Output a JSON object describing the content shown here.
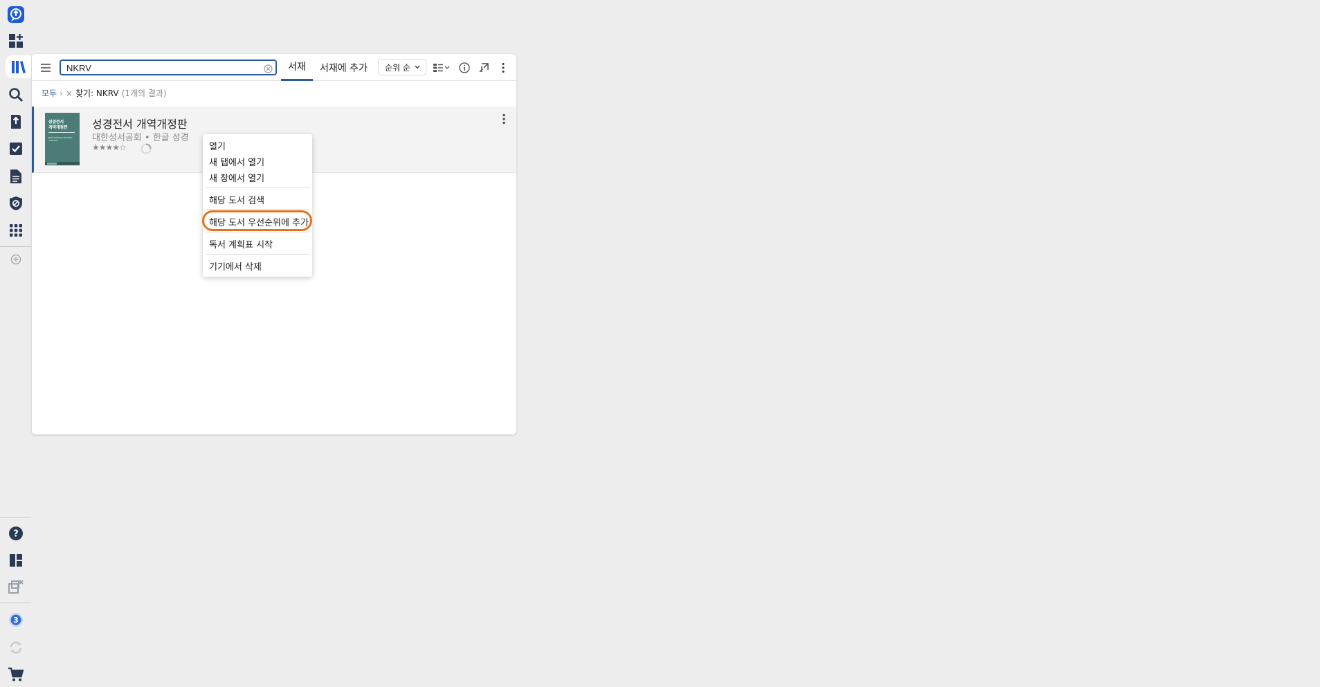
{
  "colors": {
    "accent": "#2c5aa0",
    "highlight": "#e5731b",
    "cover": "#4b7c75"
  },
  "rail": {
    "top_icons": [
      "logos-logo-icon",
      "add-panel-icon",
      "library-icon",
      "search-icon",
      "upload-icon",
      "checklist-icon",
      "document-icon",
      "shield-icon",
      "apps-grid-icon",
      "add-circle-icon"
    ],
    "bottom_icons": [
      "help-icon",
      "layout-icon",
      "close-panels-icon",
      "notification-icon",
      "sync-icon",
      "cart-icon"
    ],
    "notification_count": "3"
  },
  "toolbar": {
    "search_value": "NKRV",
    "tabs": [
      {
        "label": "서재"
      },
      {
        "label": "서재에 추가"
      }
    ],
    "sort_label": "순위 순"
  },
  "breadcrumb": {
    "root": "모두",
    "separator": "›",
    "remove": "×",
    "filter": "찾기: NKRV",
    "count": "(1개의 결과)"
  },
  "result": {
    "cover_line1": "성경전서",
    "cover_line2": "개역개정판",
    "cover_eng": "NEW KOREAN REVISED VERSION",
    "title": "성경전서 개역개정판",
    "subtitle": "대한성서공회 • 한글 성경",
    "stars": "★★★★☆",
    "rating": 4
  },
  "context_menu": {
    "items": [
      "열기",
      "새 탭에서 열기",
      "새 창에서 열기",
      "해당 도서 검색",
      "해당 도서 우선순위에 추가",
      "독서 계획표 시작",
      "기기에서 삭제"
    ]
  }
}
